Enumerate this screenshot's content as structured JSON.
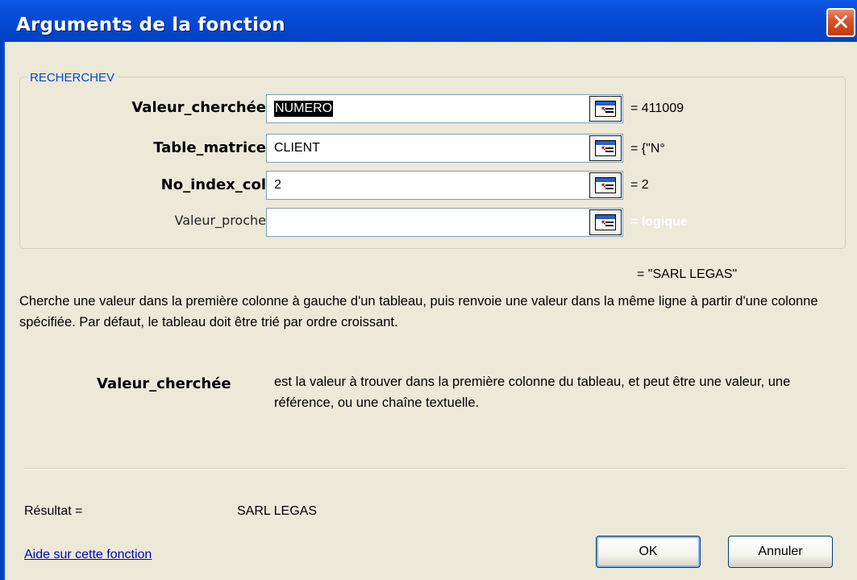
{
  "window": {
    "title": "Arguments de la fonction",
    "close_glyph": "✕"
  },
  "group": {
    "name": "RECHERCHEV",
    "args": [
      {
        "label": "Valeur_cherchée",
        "value": "NUMERO",
        "eq": "=",
        "result": "411009"
      },
      {
        "label": "Table_matrice",
        "value": "CLIENT",
        "eq": "=",
        "result": "{\"N°"
      },
      {
        "label": "No_index_col",
        "value": "2",
        "eq": "=",
        "result": "2"
      },
      {
        "label": "Valeur_proche",
        "value": "",
        "eq": "=",
        "result": "logique"
      }
    ]
  },
  "formula_result": "= \"SARL LEGAS\"",
  "description": "Cherche une valeur dans la première colonne à gauche d'un tableau, puis renvoie une valeur dans la même ligne à partir d'une colonne spécifiée. Par défaut, le tableau doit être trié par ordre croissant.",
  "argument_help": {
    "name": "Valeur_cherchée",
    "text": "est la valeur à trouver dans la première colonne du tableau, et peut être une valeur, une référence, ou une chaîne textuelle."
  },
  "footer": {
    "result_label": "Résultat =",
    "result_value": "SARL LEGAS",
    "help_link": "Aide sur cette fonction",
    "ok_label": "OK",
    "cancel_label": "Annuler"
  },
  "icons": {
    "close": "close-icon",
    "ref": "collapse-dialog-icon"
  },
  "colors": {
    "titlebar": "#0243cb",
    "dialog_bg": "#ece9d8",
    "group_title": "#0046d5",
    "link": "#0000cc"
  }
}
